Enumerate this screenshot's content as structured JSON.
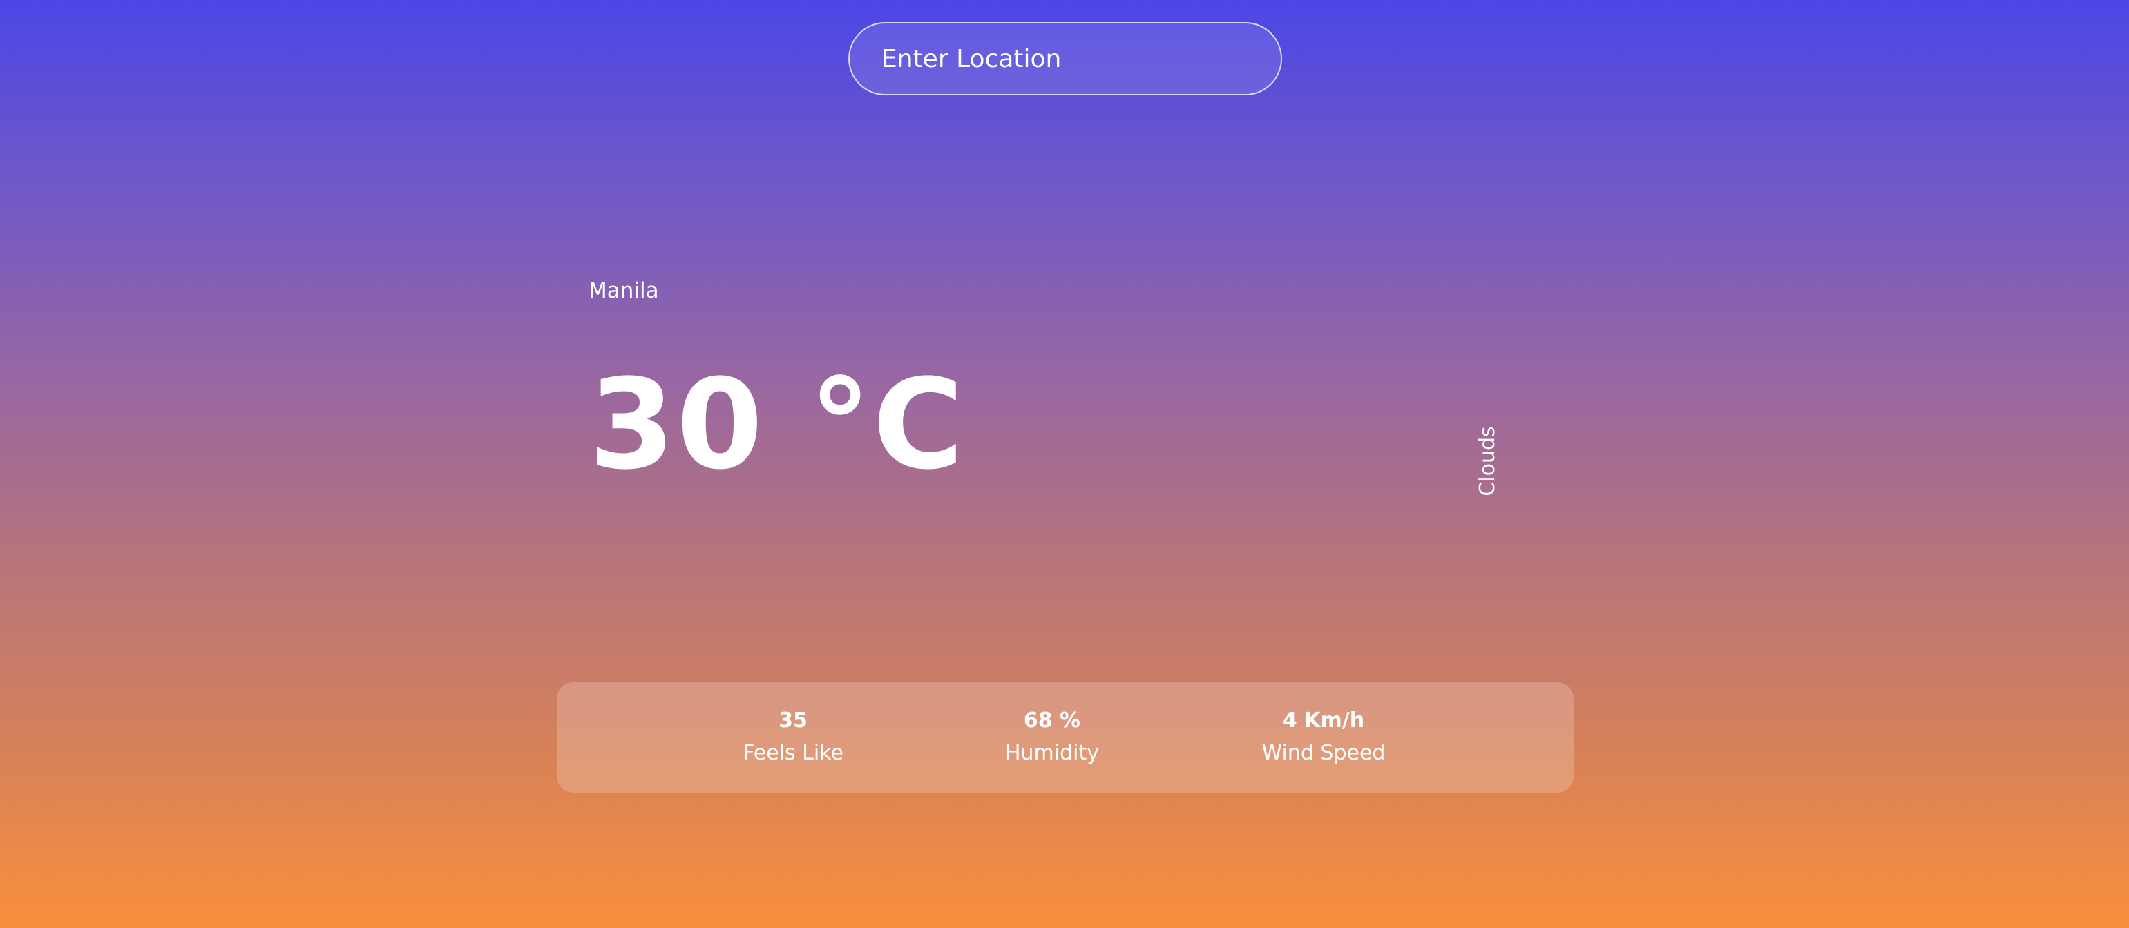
{
  "search": {
    "placeholder": "Enter Location",
    "value": "",
    "icon": "search-icon"
  },
  "weather": {
    "city": "Manila",
    "temperature": "30 °C",
    "condition": "Clouds"
  },
  "stats": [
    {
      "value": "35",
      "label": "Feels Like"
    },
    {
      "value": "68 %",
      "label": "Humidity"
    },
    {
      "value": "4 Km/h",
      "label": "Wind Speed"
    }
  ],
  "colors": {
    "gradient_top": "#4d46e6",
    "gradient_middle": "#9766a4",
    "gradient_bottom": "#f98f3c",
    "text": "#ffffff"
  }
}
